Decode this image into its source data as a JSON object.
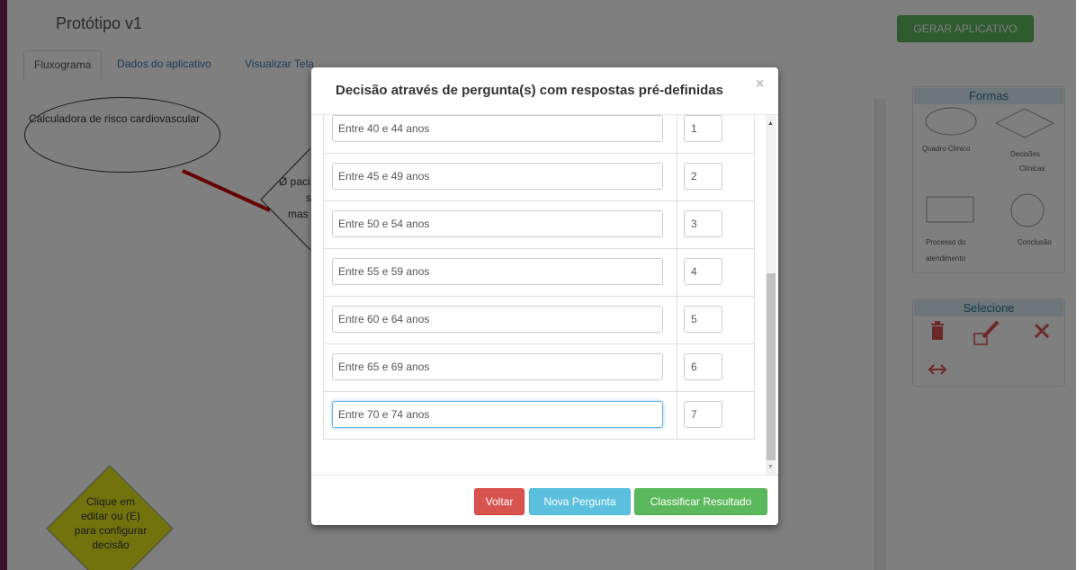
{
  "app": {
    "title": "Protótipo v1",
    "generate_label": "GERAR APLICATIVO"
  },
  "tabs": [
    {
      "label": "Fluxograma"
    },
    {
      "label": "Dados do aplicativo"
    },
    {
      "label": "Visualizar Tela"
    }
  ],
  "canvas": {
    "start_node": "Calculadora de risco cardiovascular",
    "decision_partial": [
      "Ø paci",
      "s",
      "mas"
    ],
    "new_decision": [
      "Clique em",
      "editar ou (E)",
      "para configurar",
      "decisão"
    ]
  },
  "shapes_panel": {
    "title": "Formas",
    "items": [
      "Quadro Clínico",
      "Decisões",
      "Clínicas",
      "Processo do",
      "atendimento",
      "Conclusão"
    ]
  },
  "select_panel": {
    "title": "Selecione"
  },
  "modal": {
    "title": "Decisão através de pergunta(s) com respostas pré-definidas",
    "close": "×",
    "answers": [
      {
        "text": "Entre 40 e 44 anos",
        "value": "1"
      },
      {
        "text": "Entre 45 e 49 anos",
        "value": "2"
      },
      {
        "text": "Entre 50 e 54 anos",
        "value": "3"
      },
      {
        "text": "Entre 55 e 59 anos",
        "value": "4"
      },
      {
        "text": "Entre 60 e 64 anos",
        "value": "5"
      },
      {
        "text": "Entre 65 e 69 anos",
        "value": "6"
      },
      {
        "text": "Entre 70 e 74 anos",
        "value": "7"
      }
    ],
    "buttons": {
      "back": "Voltar",
      "new_question": "Nova Pergunta",
      "classify": "Classificar Resultado"
    }
  },
  "colors": {
    "accent_red": "#d9534f",
    "accent_blue": "#5bc0de",
    "accent_green": "#5cb85c",
    "diamond_yellow": "#e6e61a",
    "connector_red": "#cc0000"
  }
}
